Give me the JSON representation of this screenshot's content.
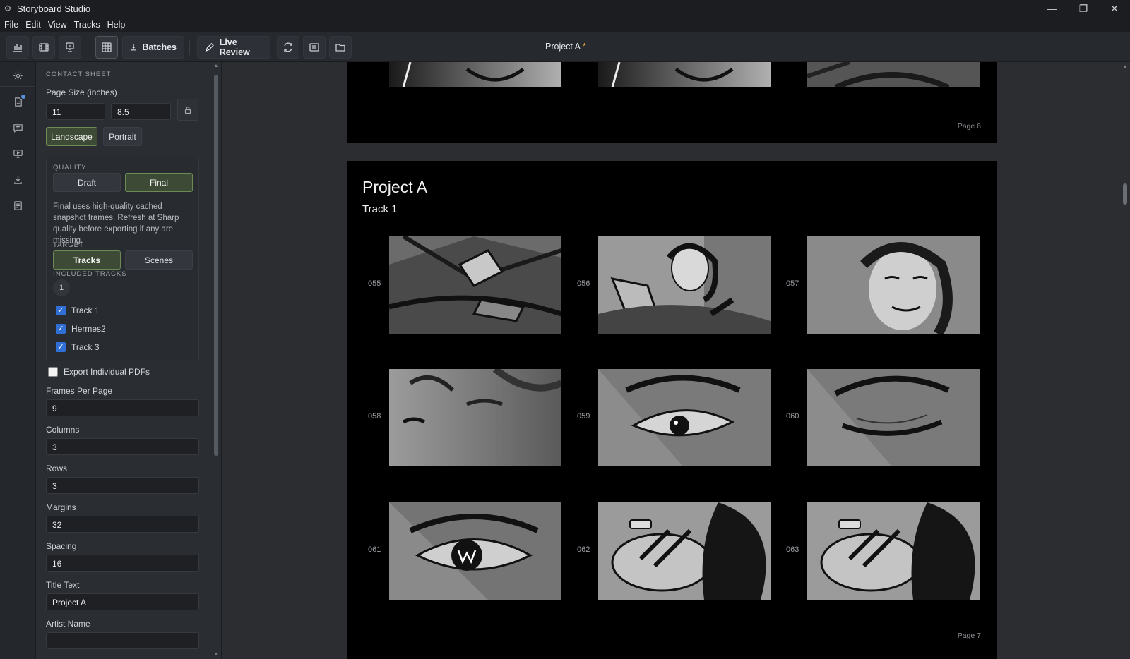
{
  "window": {
    "title": "Storyboard Studio",
    "controls": [
      "—",
      "❐",
      "✕"
    ]
  },
  "menu": [
    "File",
    "Edit",
    "View",
    "Tracks",
    "Help"
  ],
  "toolbar": {
    "batches_label": "Batches",
    "live_review_label": "Live Review",
    "project_title": "Project A",
    "unsaved_marker": "*"
  },
  "panel": {
    "section_title": "CONTACT SHEET",
    "page_size_label": "Page Size (inches)",
    "page_width": "11",
    "page_height": "8.5",
    "landscape_label": "Landscape",
    "portrait_label": "Portrait",
    "orientation_selected": "Landscape",
    "quality_title": "QUALITY",
    "draft_label": "Draft",
    "final_label": "Final",
    "quality_selected": "Final",
    "quality_desc": "Final uses high-quality cached snapshot frames. Refresh at Sharp quality before exporting if any are missing.",
    "target_title": "TARGET",
    "tracks_label": "Tracks",
    "scenes_label": "Scenes",
    "target_selected": "Tracks",
    "included_title": "INCLUDED TRACKS",
    "included_count": "1",
    "tracks": [
      {
        "label": "Track 1",
        "checked": true
      },
      {
        "label": "Hermes2",
        "checked": true
      },
      {
        "label": "Track 3",
        "checked": true
      }
    ],
    "export_individual_label": "Export Individual PDFs",
    "export_individual_checked": false,
    "frames_per_page_label": "Frames Per Page",
    "frames_per_page": "9",
    "columns_label": "Columns",
    "columns": "3",
    "rows_label": "Rows",
    "rows": "3",
    "margins_label": "Margins",
    "margins": "32",
    "spacing_label": "Spacing",
    "spacing": "16",
    "title_text_label": "Title Text",
    "title_text": "Project A",
    "artist_name_label": "Artist Name",
    "artist_name": ""
  },
  "preview": {
    "page6_label": "Page 6",
    "page7": {
      "title": "Project A",
      "track": "Track 1",
      "page_label": "Page 7",
      "frames": [
        "055",
        "056",
        "057",
        "058",
        "059",
        "060",
        "061",
        "062",
        "063"
      ]
    }
  },
  "colors": {
    "selected_accent": "#6d8a55",
    "checkbox": "#2f6fd6",
    "unsaved_dot": "#e0a040"
  }
}
